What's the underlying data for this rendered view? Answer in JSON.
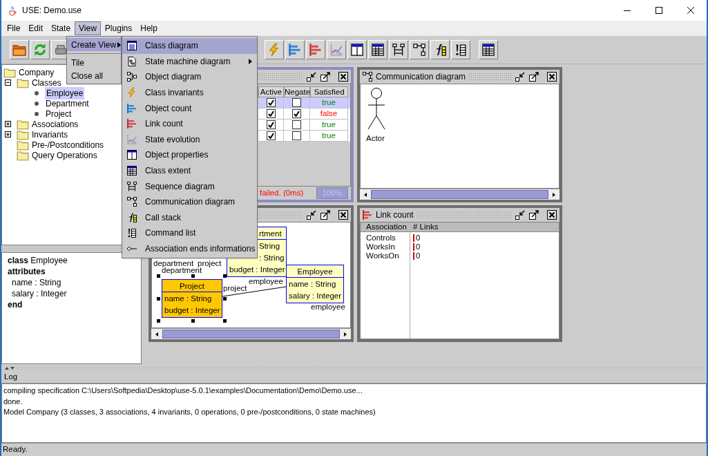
{
  "window": {
    "title": "USE: Demo.use"
  },
  "menu_bar": [
    {
      "label": "File",
      "selected": false
    },
    {
      "label": "Edit",
      "selected": false
    },
    {
      "label": "State",
      "selected": false
    },
    {
      "label": "View",
      "selected": true
    },
    {
      "label": "Plugins",
      "selected": false
    },
    {
      "label": "Help",
      "selected": false
    }
  ],
  "view_menu": [
    {
      "kind": "submenu",
      "label": "Create View",
      "selected": true
    },
    {
      "kind": "separator"
    },
    {
      "kind": "item",
      "label": "Tile",
      "selected": false
    },
    {
      "kind": "item",
      "label": "Close all",
      "selected": false
    }
  ],
  "create_view_menu": [
    {
      "label": "Class diagram",
      "selected": true,
      "submenu": false
    },
    {
      "label": "State machine diagram",
      "selected": false,
      "submenu": true
    },
    {
      "label": "Object diagram",
      "selected": false,
      "submenu": false
    },
    {
      "label": "Class invariants",
      "selected": false,
      "submenu": false
    },
    {
      "label": "Object count",
      "selected": false,
      "submenu": false
    },
    {
      "label": "Link count",
      "selected": false,
      "submenu": false
    },
    {
      "label": "State evolution",
      "selected": false,
      "submenu": false
    },
    {
      "label": "Object properties",
      "selected": false,
      "submenu": false
    },
    {
      "label": "Class extent",
      "selected": false,
      "submenu": false
    },
    {
      "label": "Sequence diagram",
      "selected": false,
      "submenu": false
    },
    {
      "label": "Communication diagram",
      "selected": false,
      "submenu": false
    },
    {
      "label": "Call stack",
      "selected": false,
      "submenu": false
    },
    {
      "label": "Command list",
      "selected": false,
      "submenu": false
    },
    {
      "label": "Association ends informations",
      "selected": false,
      "submenu": false
    }
  ],
  "model_tree": {
    "kind": "folder",
    "label": "Company",
    "children": [
      {
        "kind": "folder",
        "label": "Classes",
        "expanded": true,
        "children": [
          {
            "kind": "class",
            "label": "Employee",
            "selected": true
          },
          {
            "kind": "class",
            "label": "Department",
            "selected": false
          },
          {
            "kind": "class",
            "label": "Project",
            "selected": false
          }
        ]
      },
      {
        "kind": "folder",
        "label": "Associations",
        "expanded": false
      },
      {
        "kind": "folder",
        "label": "Invariants",
        "expanded": false
      },
      {
        "kind": "folder",
        "label": "Pre-/Postconditions"
      },
      {
        "kind": "folder",
        "label": "Query Operations"
      }
    ]
  },
  "class_details": [
    {
      "kind": "declaration",
      "text": "**class** Employee"
    },
    {
      "kind": "keyword",
      "text": "attributes"
    },
    {
      "kind": "attribute",
      "text": "name : String"
    },
    {
      "kind": "attribute",
      "text": "salary : Integer"
    },
    {
      "kind": "keyword",
      "text": "end"
    }
  ],
  "invariants_view": {
    "active": true,
    "columns": [
      "Active",
      "Negate",
      "Satisfied"
    ],
    "rows": [
      {
        "active": true,
        "negate": false,
        "satisfied": "true",
        "passed": true,
        "selected": true
      },
      {
        "active": true,
        "negate": true,
        "satisfied": "false",
        "passed": false,
        "selected": false
      },
      {
        "active": true,
        "negate": false,
        "satisfied": "true",
        "passed": true,
        "selected": false
      },
      {
        "active": true,
        "negate": false,
        "satisfied": "true",
        "passed": true,
        "selected": false
      }
    ],
    "status": "failed. (0ms)",
    "progress": {
      "text": "100%",
      "level": 1
    }
  },
  "communication_view": {
    "active": false,
    "title": "Communication diagram",
    "actor": "Actor"
  },
  "class_diagram": {
    "active": false,
    "classes": [
      {
        "name": "rtment",
        "attributes": [
          "String",
          ": String",
          "budget : Integer"
        ],
        "selected": false
      },
      {
        "name": "Project",
        "attributes": [
          "name : String",
          "budget : Integer"
        ],
        "selected": true
      },
      {
        "name": "Employee",
        "attributes": [
          "name : String",
          "salary : Integer"
        ],
        "selected": false
      }
    ],
    "role_labels": [
      "department",
      "project",
      "department",
      "project",
      "employee",
      "employee"
    ]
  },
  "link_count_view": {
    "active": false,
    "title": "Link count",
    "columns": [
      "Association",
      "# Links"
    ],
    "rows": [
      {
        "association": "Controls",
        "links": "0"
      },
      {
        "association": "WorksIn",
        "links": "0"
      },
      {
        "association": "WorksOn",
        "links": "0"
      }
    ]
  },
  "log": {
    "title": "Log",
    "lines": [
      "compiling specification C:\\Users\\Softpedia\\Desktop\\use-5.0.1\\examples\\Documentation\\Demo\\Demo.use...",
      "done.",
      "Model Company (3 classes, 3 associations, 4 invariants, 0 operations, 0 pre-/postconditions, 0 state machines)"
    ]
  },
  "status_bar": "Ready."
}
